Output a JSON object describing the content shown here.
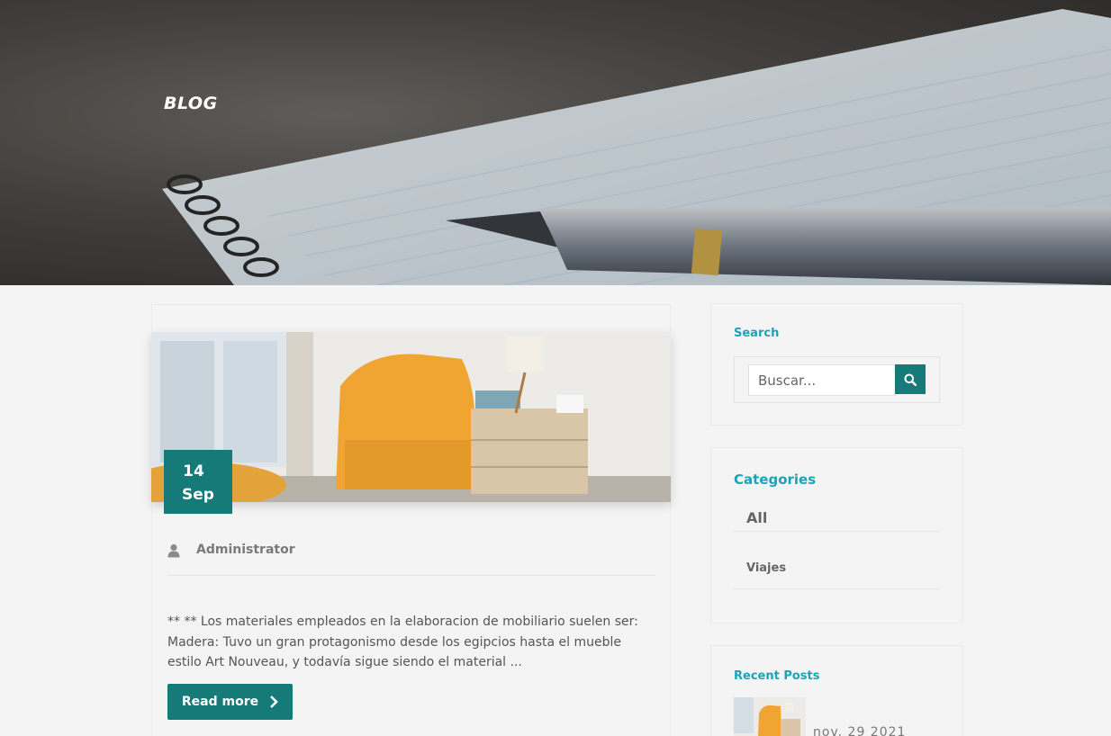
{
  "hero": {
    "title": "BLOG"
  },
  "post": {
    "date": {
      "day": "14",
      "month": "Sep"
    },
    "author": "Administrator",
    "excerpt": "** ** Los materiales empleados en la elaboracion de mobiliario suelen ser: Madera: Tuvo un gran protagonismo desde los egipcios hasta el mueble estilo Art Nouveau, y todavía sigue siendo el material ...",
    "read_more": "Read more"
  },
  "sidebar": {
    "search": {
      "title": "Search",
      "placeholder": "Buscar..."
    },
    "categories": {
      "title": "Categories",
      "items": [
        "All",
        "Viajes"
      ]
    },
    "recent": {
      "title": "Recent Posts",
      "items": [
        {
          "date": "nov. 29 2021"
        }
      ]
    }
  },
  "colors": {
    "accent": "#157a78",
    "heading": "#1ba3b8",
    "background": "#f4f4f4"
  }
}
